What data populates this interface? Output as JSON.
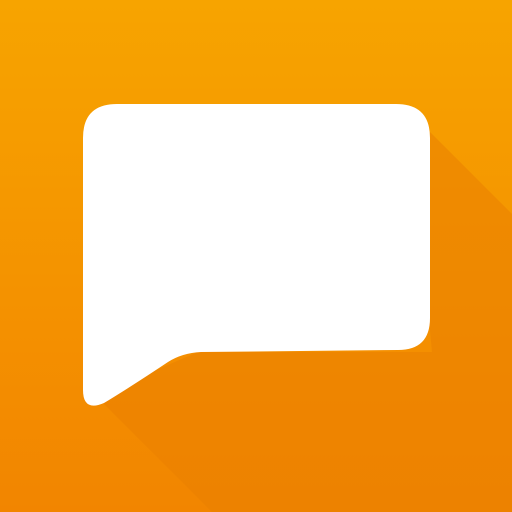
{
  "icon": {
    "name": "message-bubble-icon",
    "colors": {
      "background_top": "#F7A400",
      "background_bottom": "#F28500",
      "long_shadow": "#E97F00",
      "bubble_fill": "#FFFFFF"
    }
  }
}
